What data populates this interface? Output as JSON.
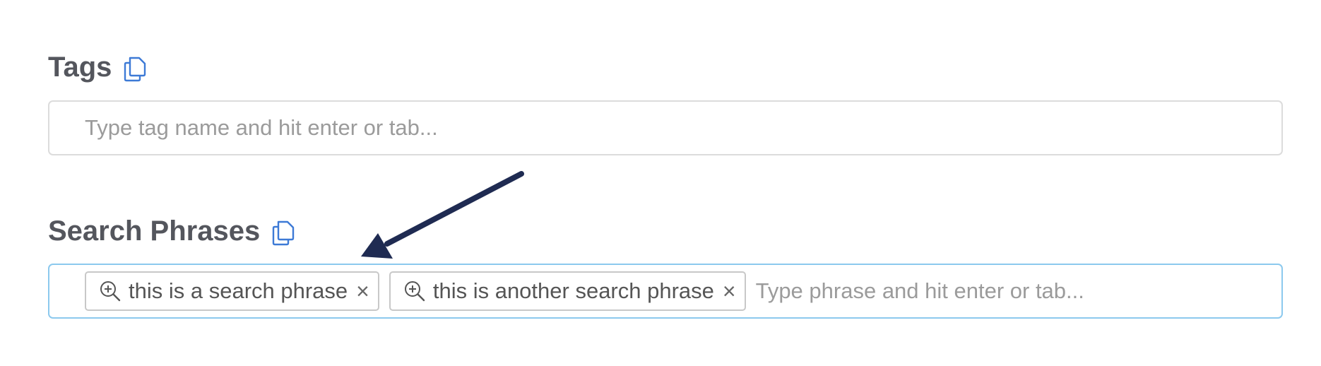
{
  "tags": {
    "label": "Tags",
    "copy_icon": "copy-icon",
    "placeholder": "Type tag name and hit enter or tab...",
    "value": ""
  },
  "search_phrases": {
    "label": "Search Phrases",
    "copy_icon": "copy-icon",
    "placeholder": "Type phrase and hit enter or tab...",
    "value": "",
    "chips": [
      {
        "text": "this is a search phrase",
        "icon": "zoom-in-icon",
        "remove": "×"
      },
      {
        "text": "this is another search phrase",
        "icon": "zoom-in-icon",
        "remove": "×"
      }
    ]
  },
  "annotation": {
    "type": "arrow",
    "color": "#1f2b52"
  },
  "colors": {
    "label_text": "#54565d",
    "icon_blue": "#3d7ad6",
    "focused_border": "#8cc9ee",
    "default_border": "#dcdcdc",
    "placeholder": "#9b9b9b"
  }
}
